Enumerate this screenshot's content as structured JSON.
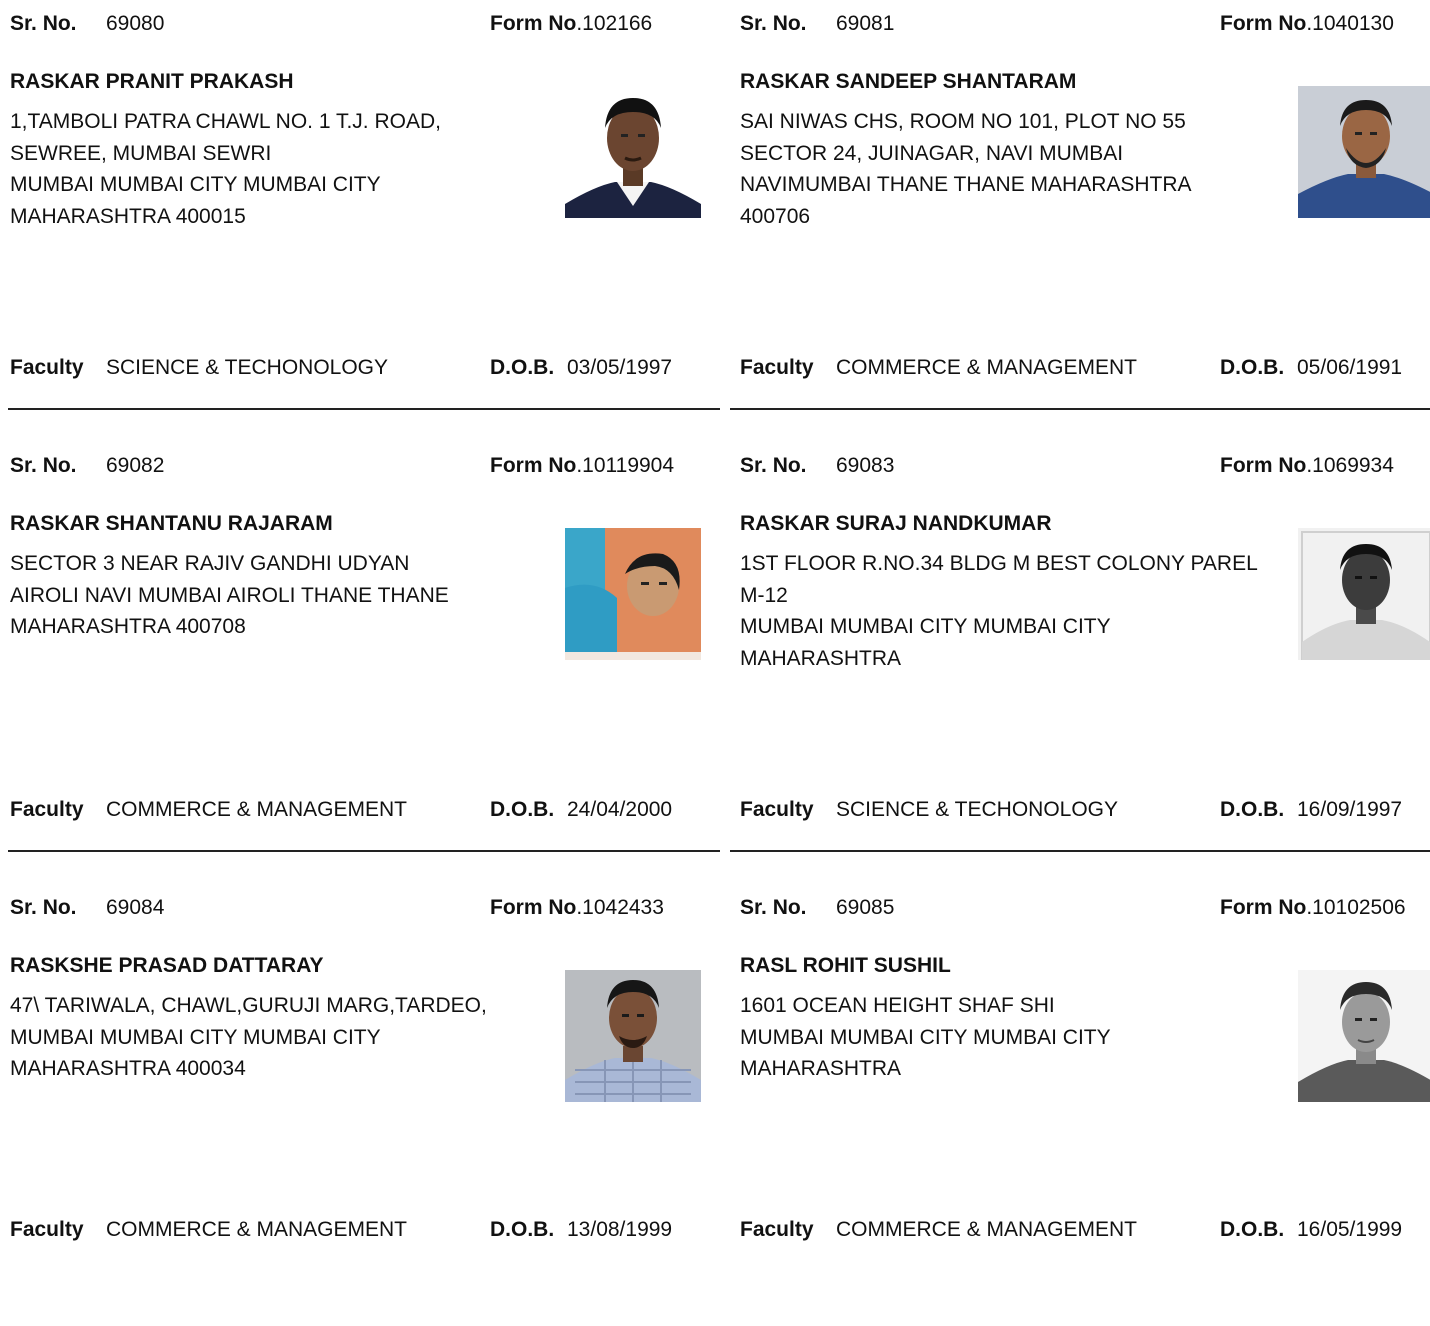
{
  "labels": {
    "sr_no": "Sr. No.",
    "form_no": "Form No",
    "faculty": "Faculty",
    "dob": "D.O.B."
  },
  "records": [
    {
      "sr_no": "69080",
      "form_no": ".102166",
      "name": "RASKAR PRANIT PRAKASH",
      "address": "1,TAMBOLI PATRA CHAWL NO. 1 T.J. ROAD,\nSEWREE, MUMBAI SEWRI\n MUMBAI MUMBAI CITY MUMBAI CITY\nMAHARASHTRA 400015",
      "faculty": "SCIENCE & TECHONOLOGY",
      "dob": "03/05/1997",
      "photo": "passport-photo-dark-suit"
    },
    {
      "sr_no": "69081",
      "form_no": ".1040130",
      "name": "RASKAR SANDEEP SHANTARAM",
      "address": "SAI NIWAS CHS, ROOM NO 101, PLOT NO 55\nSECTOR 24, JUINAGAR, NAVI MUMBAI\nNAVIMUMBAI THANE THANE MAHARASHTRA\n400706",
      "faculty": "COMMERCE & MANAGEMENT",
      "dob": "05/06/1991",
      "photo": "passport-photo-blue-shirt-beard"
    },
    {
      "sr_no": "69082",
      "form_no": ".10119904",
      "name": "RASKAR SHANTANU RAJARAM",
      "address": "SECTOR 3 NEAR RAJIV GANDHI UDYAN\nAIROLI NAVI MUMBAI AIROLI THANE THANE\nMAHARASHTRA 400708",
      "faculty": "COMMERCE & MANAGEMENT",
      "dob": "24/04/2000",
      "photo": "passport-photo-orange-background"
    },
    {
      "sr_no": "69083",
      "form_no": ".1069934",
      "name": "RASKAR SURAJ NANDKUMAR",
      "address": "1ST FLOOR R.NO.34 BLDG M BEST COLONY PAREL\nM-12\n MUMBAI MUMBAI CITY MUMBAI CITY\nMAHARASHTRA",
      "faculty": "SCIENCE & TECHONOLOGY",
      "dob": "16/09/1997",
      "photo": "passport-photo-grayscale"
    },
    {
      "sr_no": "69084",
      "form_no": ".1042433",
      "name": "RASKSHE PRASAD DATTARAY",
      "address": "47\\ TARIWALA, CHAWL,GURUJI MARG,TARDEO,\n MUMBAI MUMBAI CITY MUMBAI CITY\nMAHARASHTRA 400034",
      "faculty": "COMMERCE & MANAGEMENT",
      "dob": "13/08/1999",
      "photo": "passport-photo-checked-shirt"
    },
    {
      "sr_no": "69085",
      "form_no": ".10102506",
      "name": "RASL ROHIT SUSHIL",
      "address": "1601 OCEAN HEIGHT SHAF SHI\n MUMBAI MUMBAI CITY MUMBAI CITY\nMAHARASHTRA",
      "faculty": "COMMERCE & MANAGEMENT",
      "dob": "16/05/1999",
      "photo": "passport-photo-grayscale-tshirt"
    }
  ]
}
